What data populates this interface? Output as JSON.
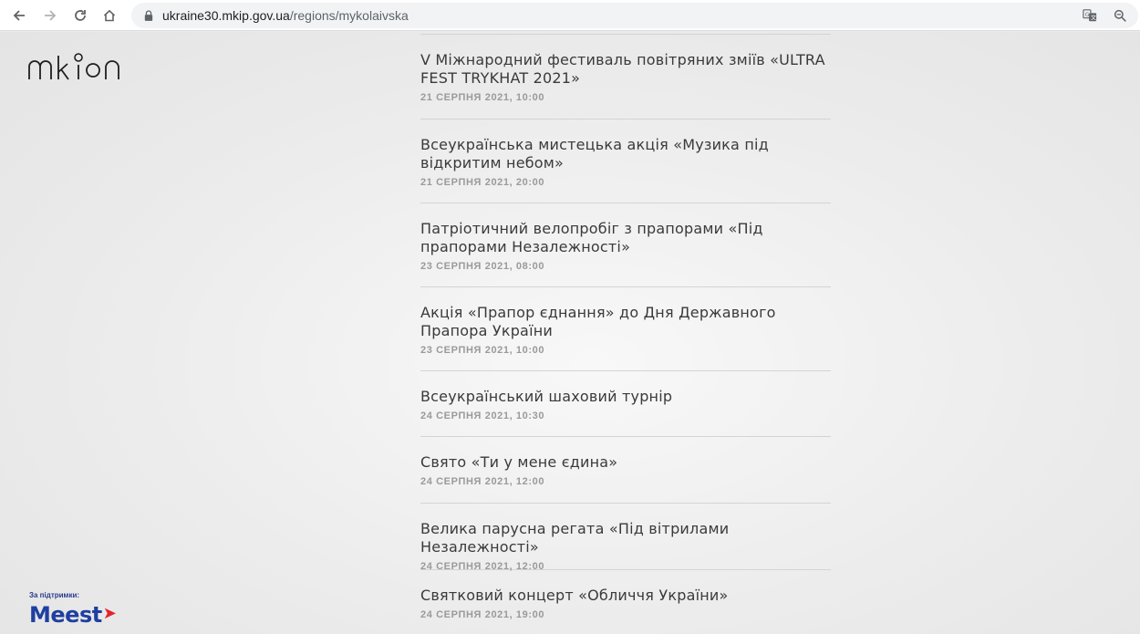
{
  "browser": {
    "url_host": "ukraine30.mkip.gov.ua",
    "url_path": "/regions/mykolaivska"
  },
  "logo": {
    "text": "mkip"
  },
  "sponsor": {
    "label": "За підтримки:",
    "brand": "Meest"
  },
  "events": [
    {
      "title": "V Міжнародний фестиваль повітряних зміїв «ULTRA FEST TRYKHAT 2021»",
      "date": "21 серпня 2021, 10:00"
    },
    {
      "title": "Всеукраїнська мистецька акція «Музика під відкритим небом»",
      "date": "21 серпня 2021, 20:00"
    },
    {
      "title": "Патріотичний велопробіг з прапорами «Під прапорами Незалежності»",
      "date": "23 серпня 2021, 08:00"
    },
    {
      "title": "Акція «Прапор єднання» до Дня Державного Прапора України",
      "date": "23 серпня 2021, 10:00"
    },
    {
      "title": "Всеукраїнський шаховий турнір",
      "date": "24 серпня 2021, 10:30"
    },
    {
      "title": "Свято «Ти у мене єдина»",
      "date": "24 серпня 2021, 12:00"
    },
    {
      "title": "Велика парусна регата «Під вітрилами Незалежності»",
      "date": "24 серпня 2021, 12:00"
    },
    {
      "title": "Святковий концерт «Обличчя України»",
      "date": "24 серпня 2021, 19:00"
    }
  ]
}
